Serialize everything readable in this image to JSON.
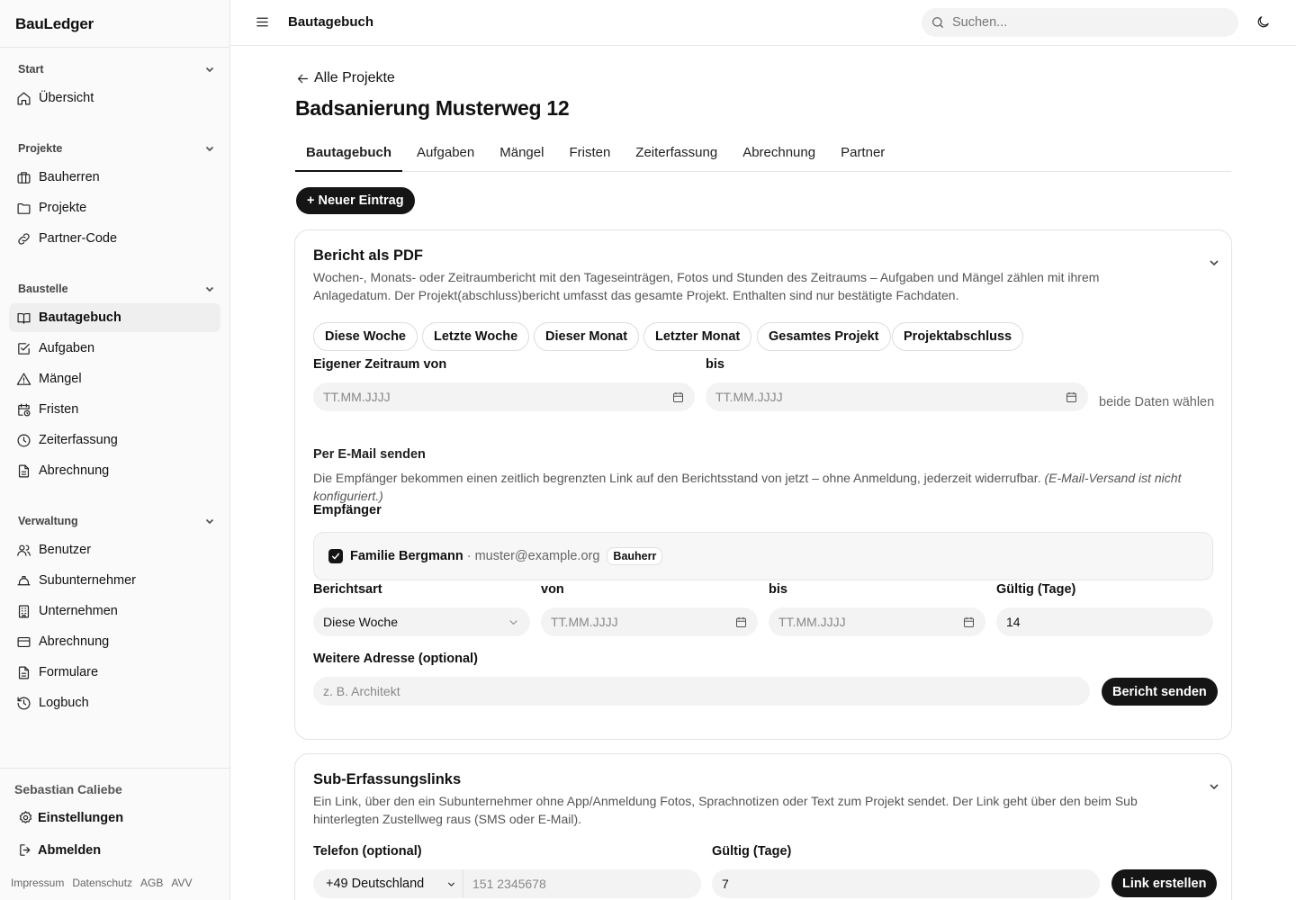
{
  "app": {
    "brand": "BauLedger"
  },
  "sidebar": {
    "groups": [
      {
        "label": "Start",
        "items": [
          {
            "label": "Übersicht",
            "icon": "home-icon"
          }
        ]
      },
      {
        "label": "Projekte",
        "items": [
          {
            "label": "Bauherren",
            "icon": "briefcase-icon"
          },
          {
            "label": "Projekte",
            "icon": "folder-icon"
          },
          {
            "label": "Partner-Code",
            "icon": "link-icon"
          }
        ]
      },
      {
        "label": "Baustelle",
        "items": [
          {
            "label": "Bautagebuch",
            "icon": "book-icon",
            "active": true
          },
          {
            "label": "Aufgaben",
            "icon": "check-square-icon"
          },
          {
            "label": "Mängel",
            "icon": "warning-icon"
          },
          {
            "label": "Fristen",
            "icon": "calendar-clock-icon"
          },
          {
            "label": "Zeiterfassung",
            "icon": "clock-icon"
          },
          {
            "label": "Abrechnung",
            "icon": "document-icon"
          }
        ]
      },
      {
        "label": "Verwaltung",
        "items": [
          {
            "label": "Benutzer",
            "icon": "users-icon"
          },
          {
            "label": "Subunternehmer",
            "icon": "hard-hat-icon"
          },
          {
            "label": "Unternehmen",
            "icon": "building-icon"
          },
          {
            "label": "Abrechnung",
            "icon": "credit-card-icon"
          },
          {
            "label": "Formulare",
            "icon": "document-icon"
          },
          {
            "label": "Logbuch",
            "icon": "history-icon"
          }
        ]
      }
    ],
    "footer": {
      "user_name": "Sebastian Caliebe",
      "settings": "Einstellungen",
      "logout": "Abmelden",
      "legal": [
        "Impressum",
        "Datenschutz",
        "AGB",
        "AVV"
      ]
    }
  },
  "topbar": {
    "title": "Bautagebuch",
    "search_placeholder": "Suchen..."
  },
  "main": {
    "back_link": "Alle Projekte",
    "title": "Badsanierung Musterweg 12",
    "tabs": [
      "Bautagebuch",
      "Aufgaben",
      "Mängel",
      "Fristen",
      "Zeiterfassung",
      "Abrechnung",
      "Partner"
    ],
    "active_tab": "Bautagebuch",
    "new_entry_button": "+ Neuer Eintrag"
  },
  "pdf_card": {
    "title": "Bericht als PDF",
    "description": "Wochen-, Monats- oder Zeitraumbericht mit den Tageseinträgen, Fotos und Stunden des Zeitraums – Aufgaben und Mängel zählen mit ihrem Anlagedatum. Der Projekt(abschluss)bericht umfasst das gesamte Projekt. Enthalten sind nur bestätigte Fachdaten.",
    "presets": [
      "Diese Woche",
      "Letzte Woche",
      "Dieser Monat",
      "Letzter Monat",
      "Gesamtes Projekt",
      "Projektabschluss"
    ],
    "custom_from_label": "Eigener Zeitraum von",
    "custom_to_label": "bis",
    "date_placeholder": "TT.MM.JJJJ",
    "date_hint": "beide Daten wählen",
    "email": {
      "heading": "Per E-Mail senden",
      "description": "Die Empfänger bekommen einen zeitlich begrenzten Link auf den Berichtsstand von jetzt – ohne Anmeldung, jederzeit widerrufbar.",
      "description_note": "(E-Mail-Versand ist nicht konfiguriert.)",
      "recipients_label": "Empfänger",
      "recipient": {
        "name": "Familie Bergmann",
        "separator": " · ",
        "email": "muster@example.org",
        "role": "Bauherr",
        "checked": true
      },
      "report_type_label": "Berichtsart",
      "report_type_value": "Diese Woche",
      "from_label": "von",
      "to_label": "bis",
      "valid_label": "Gültig (Tage)",
      "valid_value": "14",
      "extra_address_label": "Weitere Adresse (optional)",
      "extra_address_placeholder": "z. B. Architekt",
      "send_button": "Bericht senden"
    }
  },
  "sub_card": {
    "title": "Sub-Erfassungslinks",
    "description": "Ein Link, über den ein Subunternehmer ohne App/Anmeldung Fotos, Sprachnotizen oder Text zum Projekt sendet. Der Link geht über den beim Sub hinterlegten Zustellweg raus (SMS oder E-Mail).",
    "phone_label": "Telefon (optional)",
    "country_value": "+49 Deutschland",
    "phone_placeholder": "151 2345678",
    "valid_label": "Gültig (Tage)",
    "valid_value": "7",
    "create_button": "Link erstellen"
  }
}
